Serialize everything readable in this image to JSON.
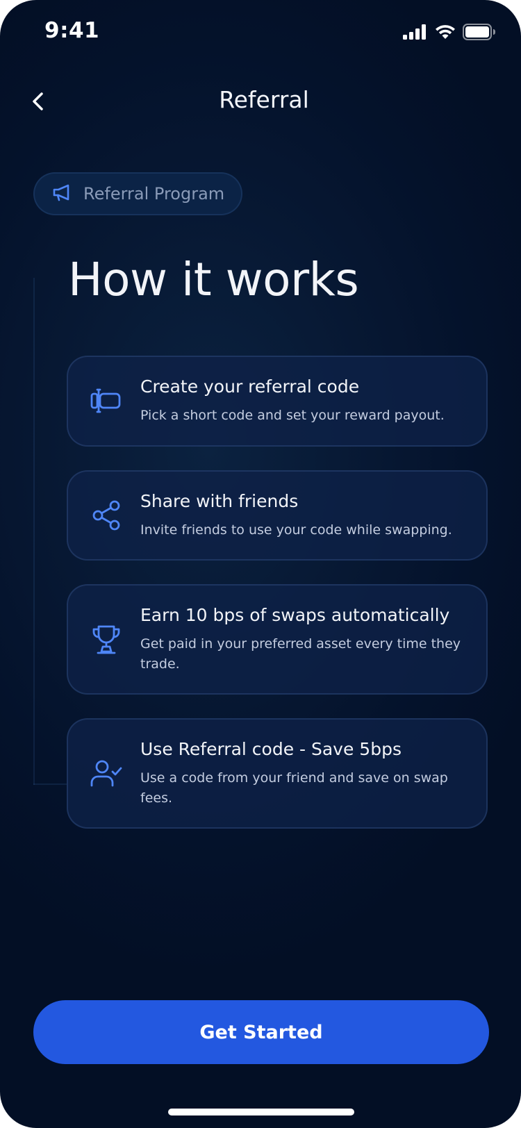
{
  "status_bar": {
    "time": "9:41",
    "signal_icon": "signal-icon",
    "wifi_icon": "wifi-icon",
    "battery_icon": "battery-icon"
  },
  "header": {
    "back_icon": "chevron-left-icon",
    "title": "Referral"
  },
  "program_badge": {
    "icon": "megaphone-icon",
    "label": "Referral Program"
  },
  "section_title": "How it works",
  "steps": [
    {
      "icon": "code-cursor-icon",
      "title": "Create your referral code",
      "description": "Pick a short code and set your reward payout."
    },
    {
      "icon": "share-icon",
      "title": "Share with friends",
      "description": "Invite friends to use your code while swapping."
    },
    {
      "icon": "trophy-icon",
      "title": "Earn 10 bps of swaps automatically",
      "description": "Get paid in your preferred asset every time they trade."
    },
    {
      "icon": "user-check-icon",
      "title": "Use Referral code - Save 5bps",
      "description": "Use a code from your friend and save on swap fees."
    }
  ],
  "cta": {
    "label": "Get Started"
  },
  "colors": {
    "background": "#04122b",
    "card": "#0e2148",
    "accent": "#2358e0",
    "icon_blue": "#4f86f7"
  }
}
